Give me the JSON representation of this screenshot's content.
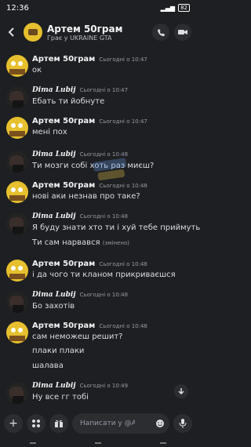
{
  "status_bar": {
    "time": "12:36",
    "battery": "82"
  },
  "header": {
    "title": "Артем 50грам",
    "subtitle": "Грає у UKRAINE GTA"
  },
  "messages": [
    {
      "author": "Артем 50грам",
      "timestamp": "Сьогодні о 10:47",
      "avatar": "spongebob-avatar",
      "lines": [
        "ок"
      ]
    },
    {
      "author": "Dima Lubij",
      "timestamp": "Сьогодні о 10:47",
      "avatar": "dark-avatar",
      "lines": [
        "Ебать ти йобнуте"
      ]
    },
    {
      "author": "Артем 50грам",
      "timestamp": "Сьогодні о 10:47",
      "avatar": "spongebob-avatar",
      "lines": [
        "мені пох"
      ]
    },
    {
      "author": "Dima Lubij",
      "timestamp": "Сьогодні о 10:48",
      "avatar": "dark-avatar",
      "lines": [
        "Ти мозги собі хоть раз миєш?"
      ]
    },
    {
      "author": "Артем 50грам",
      "timestamp": "Сьогодні о 10:48",
      "avatar": "spongebob-avatar",
      "lines": [
        "нові аки незнав про таке?"
      ]
    },
    {
      "author": "Dima Lubij",
      "timestamp": "Сьогодні о 10:48",
      "avatar": "dark-avatar",
      "lines": [
        "Я буду знати хто ти і хуй тебе приймуть",
        "Ти сам нарвався"
      ],
      "edited": "(змінено)"
    },
    {
      "author": "Артем 50грам",
      "timestamp": "Сьогодні о 10:48",
      "avatar": "spongebob-avatar",
      "lines": [
        "і да чого ти кланом прикриваєшся"
      ]
    },
    {
      "author": "Dima Lubij",
      "timestamp": "Сьогодні о 10:48",
      "avatar": "dark-avatar",
      "lines": [
        "Бо захотів"
      ]
    },
    {
      "author": "Артем 50грам",
      "timestamp": "Сьогодні о 10:48",
      "avatar": "spongebob-avatar",
      "lines": [
        "сам неможеш решит?",
        "плаки плаки",
        "шалава"
      ]
    },
    {
      "author": "Dima Lubij",
      "timestamp": "Сьогодні о 10:49",
      "avatar": "dark-avatar",
      "lines": [
        "Ну все гг тобі"
      ]
    }
  ],
  "composer": {
    "placeholder": "Написати у @A..."
  },
  "icons": {
    "back": "arrow-left-icon",
    "call": "phone-icon",
    "video": "video-camera-icon",
    "add": "plus-icon",
    "apps": "apps-icon",
    "gift": "gift-icon",
    "emoji": "emoji-icon",
    "voice": "microphone-icon",
    "scroll": "arrow-down-icon"
  },
  "colors": {
    "background": "#1e1f22",
    "surface": "#2b2d31",
    "text": "#dbdee1",
    "muted": "#949ba4"
  }
}
